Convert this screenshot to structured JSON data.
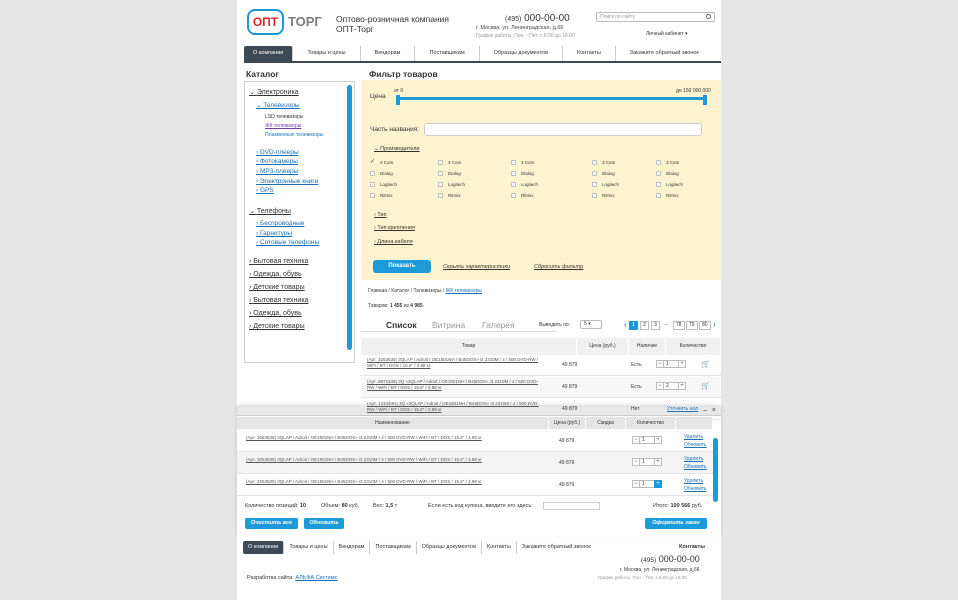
{
  "header": {
    "logo_box": "ОПТ",
    "logo_word": "ТОРГ",
    "company_line1": "Оптово-розничная компания",
    "company_line2": "ОПТ-Торг",
    "phone_code": "(495)",
    "phone_num": "000-00-00",
    "address": "г. Москва, ул. Ленинградская, д.66",
    "hours": "График работы: Пон. - Пят. с 8.00 до 18.00",
    "search_placeholder": "Поиск по сайту",
    "cabinet": "Личный кабинет"
  },
  "nav": [
    "О компании",
    "Товары и цены",
    "Вендорам",
    "Поставщикам",
    "Образцы документов",
    "Контакты",
    "Закажите обратный звонок"
  ],
  "catalog": {
    "title": "Каталог",
    "electronics": "Электроника",
    "tv": "Телевизоры",
    "lsd": "LSD телевизоры",
    "lcd": "ЖК телевизоры",
    "plasma": "Плазменные телевизоры",
    "dvd": "DVD-плееры",
    "cameras": "Фотокамеры",
    "mp3": "MP3-плееры",
    "ebooks": "Электронные книги",
    "gps": "GPS",
    "phones": "Телефоны",
    "wireless": "Беспроводные",
    "headsets": "Гарнитуры",
    "cellular": "Сотовые телефоны",
    "home": "Бытовая техника",
    "clothes": "Одежда, обувь",
    "kids": "Детские товары",
    "home2": "Бытовая техника",
    "clothes2": "Одежда, обувь",
    "kids2": "Детские товары"
  },
  "filter": {
    "title": "Фильтр товаров",
    "price_label": "Цена",
    "price_from": "от 0",
    "price_to": "до 150 000 000",
    "name_label": "Часть названия:",
    "makers": "Производители",
    "options": [
      "3 Com",
      "Dialog",
      "Logitech",
      "Ritmix"
    ],
    "checked": "3 Com",
    "type": "Тип",
    "mount": "Тип крепления",
    "cable": "Длина кабеля",
    "show": "Показать",
    "hide": "Скрыть характеристики",
    "reset": "Сбросить фильтр"
  },
  "listing": {
    "bc_plain": "Главная / Каталог / Телевизоры / ",
    "bc_current": "ЖК телевизоры",
    "count_label": "Товаров:",
    "count_value": "1 455",
    "count_of": "из",
    "count_total": "4 985",
    "view_list": "Список",
    "view_showcase": "Витрина",
    "view_gallery": "Галерея",
    "per_page_label": "Выводить по:",
    "per_page": "5",
    "pages": [
      "1",
      "2",
      "3",
      "...",
      "78",
      "79",
      "80"
    ],
    "cols": [
      "Товар",
      "Цена (руб.)",
      "Наличие",
      "Количество"
    ]
  },
  "products": [
    {
      "name": "(Арт. 3253535) 3QLAP / Adroit / OE1501NH / B45DOS» i3 2310M / 4 / 500 DVD-RW / WiFi / BT / DOS / 15.6\" / 2.88 кг",
      "price": "49 879",
      "avail": "Есть",
      "qty": "1"
    },
    {
      "name": "(Арт. 8972349) 3Q «3QLAP / Adroit / OE1501NH / B45DOS» i3 2310M / 4 / 500 DVD-RW / WiFi / BT / DOS / 15.6\" / 2.88 кг",
      "price": "49 879",
      "avail": "Есть",
      "qty": "2"
    },
    {
      "name": "(Арт. 123334Н) 3Q «3QLAP / Adroit / OE1501NH / B45DOS» i3 2310M / 4 / 500 DVD-RW / WiFi / BT / DOS / 15.6\" / 2.88 кг",
      "price": "49 879",
      "avail": "Нет",
      "qty": "",
      "clarify": "Уточнить нал"
    }
  ],
  "cart": {
    "cols": [
      "Наименование",
      "Цена (руб.)",
      "Скидка",
      "Количество"
    ],
    "items": [
      {
        "name": "(Арт. 3253535) 3QLAP / Adroit / OE1501NH / B45DOS» i3 2310M / 4 / 500 DVD-RW / WiFi / BT / DOS / 15.6\" / 2.88 кг",
        "price": "49 879",
        "qty": "1"
      },
      {
        "name": "(Арт. 3253535) 3QLAP / Adroit / OE1501NH / B45DOS» i3 2310M / 4 / 500 DVD-RW / WiFi / BT / DOS / 15.6\" / 2.88 кг",
        "price": "49 879",
        "qty": "1"
      },
      {
        "name": "(Арт. 3253535) 3QLAP / Adroit / OE1501NH / B45DOS» i3 2310M / 4 / 500 DVD-RW / WiFi / BT / DOS / 15.6\" / 2.88 кг",
        "price": "49 879",
        "qty": "1"
      }
    ],
    "del": "Удалить",
    "upd": "Обновить",
    "pos_label": "Количество позиций:",
    "pos": "10",
    "vol_label": "Объем:",
    "vol": "80",
    "vol_unit": "куб.",
    "weight_label": "Вес:",
    "weight": "1,5",
    "weight_unit": "т",
    "coupon_label": "Если есть код купона, введите его здесь:",
    "total_label": "Итого:",
    "total": "100 566",
    "total_unit": "руб.",
    "clear": "Очистить все",
    "refresh": "Обновить",
    "order": "Оформить заказ"
  },
  "footer": {
    "nav": [
      "О компании",
      "Товары и цены",
      "Вендорам",
      "Поставщикам",
      "Образцы документов",
      "Контакты",
      "Закажите обратный звонок"
    ],
    "contacts": "Контакты",
    "phone_code": "(495)",
    "phone_num": "000-00-00",
    "address": "г. Москва, ул. Ленинградская, д.66",
    "hours": "График работы: Пон. - Пят. с 8.00 до 18.00",
    "dev_label": "Разработка сайта:",
    "dev": "АЛЬФА Системс"
  },
  "colors": {
    "accent": "#1d9ad9",
    "nav": "#3d4a55",
    "filter_bg": "#fdf4cf",
    "logo_red": "#d7262b"
  }
}
